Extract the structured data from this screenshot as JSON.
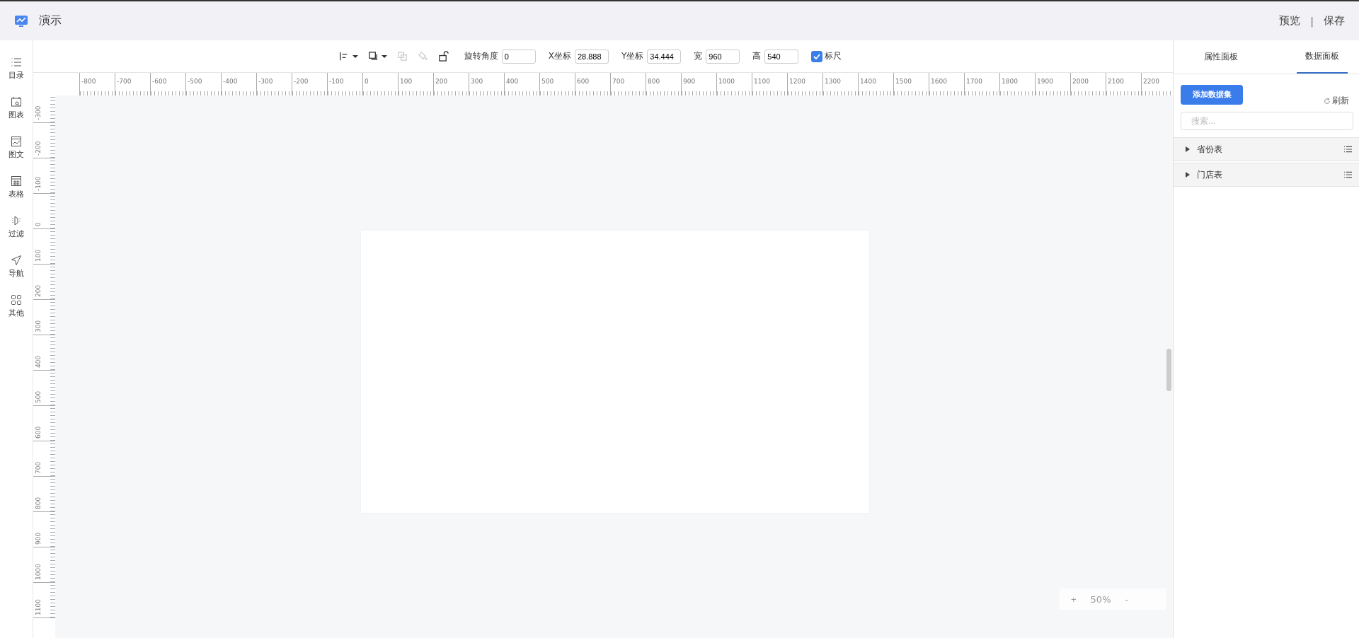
{
  "header": {
    "title": "演示",
    "actions": [
      {
        "label": "预览"
      },
      {
        "label": "保存"
      }
    ],
    "separator": "|"
  },
  "sidebar": {
    "items": [
      {
        "label": "目录",
        "kind": "list"
      },
      {
        "label": "图表",
        "kind": "chart"
      },
      {
        "label": "图文",
        "kind": "image"
      },
      {
        "label": "表格",
        "kind": "table"
      },
      {
        "label": "过滤",
        "kind": "filter"
      },
      {
        "label": "导航",
        "kind": "nav"
      },
      {
        "label": "其他",
        "kind": "grid"
      }
    ]
  },
  "toolbar": {
    "tools": [
      {
        "kind": "align",
        "disabled": false,
        "has_menu": true
      },
      {
        "kind": "layer",
        "disabled": false,
        "has_menu": true
      },
      {
        "kind": "group",
        "disabled": true,
        "has_menu": false
      },
      {
        "kind": "ungroup",
        "disabled": true,
        "has_menu": false
      },
      {
        "kind": "lock",
        "disabled": false,
        "has_menu": false
      }
    ],
    "fields": [
      {
        "label": "旋转角度",
        "value": "0"
      },
      {
        "label": "X坐标",
        "value": "28.888"
      },
      {
        "label": "Y坐标",
        "value": "34.444"
      },
      {
        "label": "宽",
        "value": "960"
      },
      {
        "label": "高",
        "value": "540"
      }
    ],
    "ruler_toggle": {
      "label": "标尺",
      "checked": true
    }
  },
  "rulers": {
    "horizontal": [
      "-800",
      "-700",
      "-600",
      "-500",
      "-400",
      "-300",
      "-200",
      "-100",
      "0",
      "100",
      "200",
      "300",
      "400",
      "500",
      "600",
      "700",
      "800",
      "900",
      "1000",
      "1100",
      "1200",
      "1300",
      "1400",
      "1500",
      "1600",
      "1700",
      "1800",
      "1900",
      "2000",
      "2100",
      "2200"
    ],
    "vertical": [
      "-300",
      "-200",
      "-100",
      "0",
      "100",
      "200",
      "300",
      "400",
      "500",
      "600",
      "700",
      "800",
      "900",
      "1000",
      "1100"
    ]
  },
  "zoom": {
    "zoom_in": "+",
    "level": "50%",
    "zoom_out": "-"
  },
  "panel": {
    "tabs": [
      {
        "label": "属性面板",
        "selected": false
      },
      {
        "label": "数据面板",
        "selected": true
      }
    ],
    "add_button": "添加数据集",
    "refresh": "刷新",
    "search": {
      "placeholder": "搜索..."
    },
    "datasets": [
      {
        "name": "省份表",
        "expanded": false
      },
      {
        "name": "门店表",
        "expanded": false
      }
    ]
  }
}
